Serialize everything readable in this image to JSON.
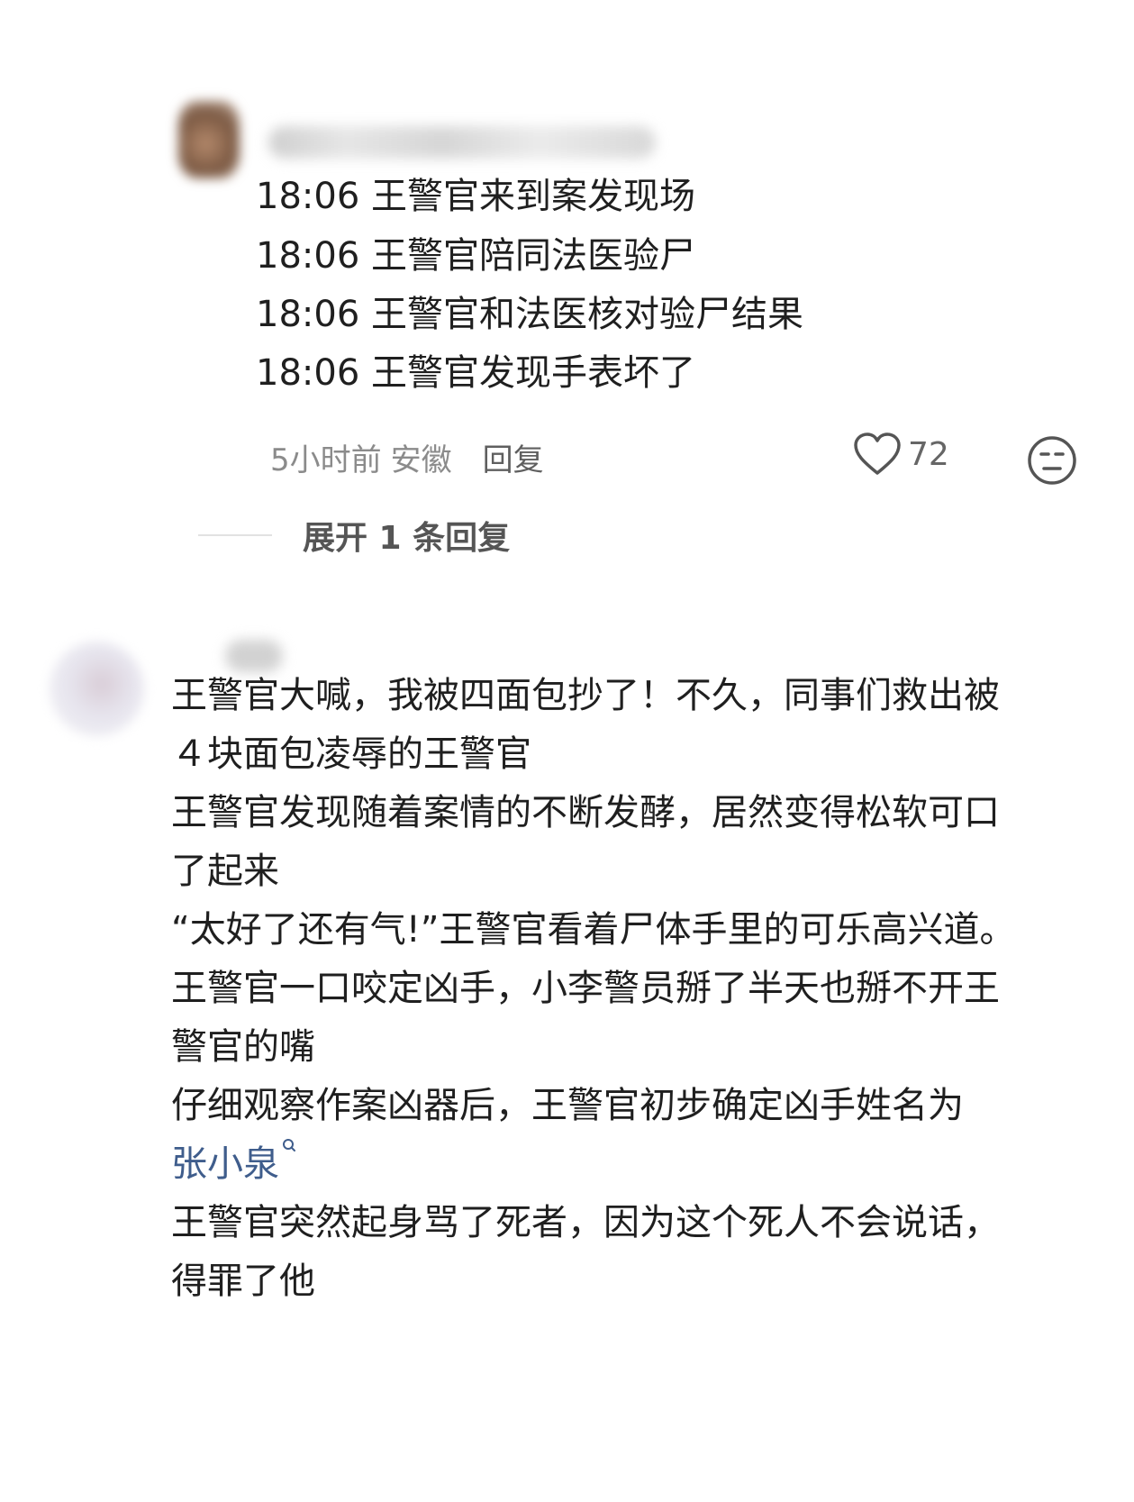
{
  "comment1": {
    "lines": [
      "18:06 王警官来到案发现场",
      "18:06 王警官陪同法医验尸",
      "18:06 王警官和法医核对验尸结果",
      "18:06 王警官发现手表坏了"
    ],
    "time": "5小时前",
    "location": "安徽",
    "reply_label": "回复",
    "like_count": "72",
    "expand_label": "展开 1 条回复"
  },
  "comment2": {
    "lines": [
      "王警官大喊，我被四面包抄了！不久，同事们救出被",
      "４块面包凌辱的王警官",
      "王警官发现随着案情的不断发酵，居然变得松软可口",
      "了起来",
      "“太好了还有气!”王警官看着尸体手里的可乐高兴道。",
      "王警官一口咬定凶手，小李警员掰了半天也掰不开王",
      "警官的嘴",
      "仔细观察作案凶器后，王警官初步确定凶手姓名为",
      "王警官突然起身骂了死者，因为这个死人不会说话，",
      "得罪了他"
    ],
    "link_text": "张小泉"
  },
  "icons": {
    "like": "heart-outline-icon",
    "dislike": "neutral-face-icon",
    "search": "search-mini-icon"
  },
  "colors": {
    "text": "#1f1f1f",
    "meta": "#8b8b8b",
    "link": "#3f5d8c"
  }
}
